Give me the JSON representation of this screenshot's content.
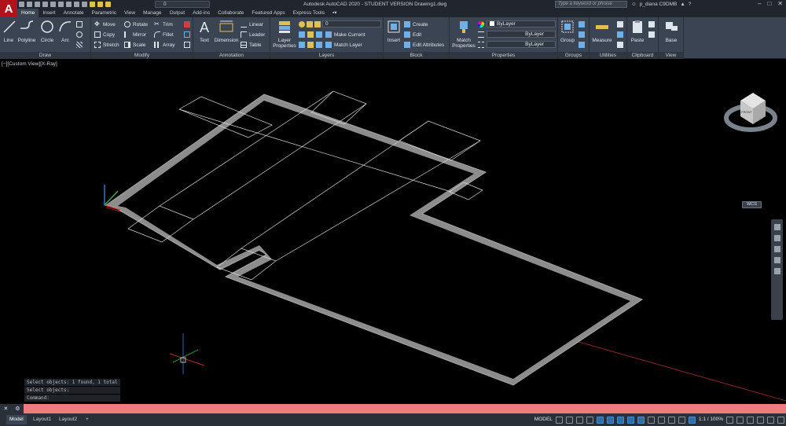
{
  "app": {
    "logo_letter": "A",
    "title": "Autodesk AutoCAD 2020 - STUDENT VERSION    Drawing1.dwg",
    "search_placeholder": "Type a keyword or phrase",
    "user": "p_diana C9DMB",
    "layer_value": "0"
  },
  "tabs": [
    "Home",
    "Insert",
    "Annotate",
    "Parametric",
    "View",
    "Manage",
    "Output",
    "Add-ins",
    "Collaborate",
    "Featured Apps",
    "Express Tools"
  ],
  "active_tab": "Home",
  "ribbon": {
    "draw": {
      "label": "Draw",
      "line": "Line",
      "polyline": "Polyline",
      "circle": "Circle",
      "arc": "Arc"
    },
    "modify": {
      "label": "Modify",
      "move": "Move",
      "rotate": "Rotate",
      "trim": "Trim",
      "copy": "Copy",
      "mirror": "Mirror",
      "fillet": "Fillet",
      "stretch": "Stretch",
      "scale": "Scale",
      "array": "Array"
    },
    "annotation": {
      "label": "Annotation",
      "text": "Text",
      "dimension": "Dimension",
      "linear": "Linear",
      "leader": "Leader",
      "table": "Table"
    },
    "layers": {
      "label": "Layers",
      "layer_properties": "Layer Properties",
      "layer_value": "0",
      "make_current": "Make Current",
      "match_layer": "Match Layer"
    },
    "block": {
      "label": "Block",
      "insert": "Insert",
      "create": "Create",
      "edit": "Edit",
      "edit_attributes": "Edit Attributes"
    },
    "properties": {
      "label": "Properties",
      "match_properties": "Match Properties",
      "color": "ByLayer",
      "linetype": "ByLayer",
      "lineweight": "ByLayer"
    },
    "groups": {
      "label": "Groups",
      "group": "Group"
    },
    "utilities": {
      "label": "Utilities",
      "measure": "Measure"
    },
    "clipboard": {
      "label": "Clipboard",
      "paste": "Paste"
    },
    "view": {
      "label": "View",
      "base": "Base"
    }
  },
  "viewport": {
    "label": "[−][Custom View][X-Ray]",
    "viewcube_face": "FRONT",
    "wcs": "WCS"
  },
  "command_history": [
    "Select objects: 1 found, 1 total",
    "Select objects:",
    "Command:"
  ],
  "command_prompt": "",
  "layout_tabs": [
    "Model",
    "Layout1",
    "Layout2"
  ],
  "active_layout": "Model",
  "status": {
    "model": "MODEL",
    "scale": "1:1 / 100%"
  },
  "colors": {
    "accent_red": "#b3121b",
    "command_bar": "#f17b7b",
    "ribbon_bg": "#3b4452",
    "drawing_bg": "#000000",
    "wall_fill": "#8c8c8c"
  }
}
